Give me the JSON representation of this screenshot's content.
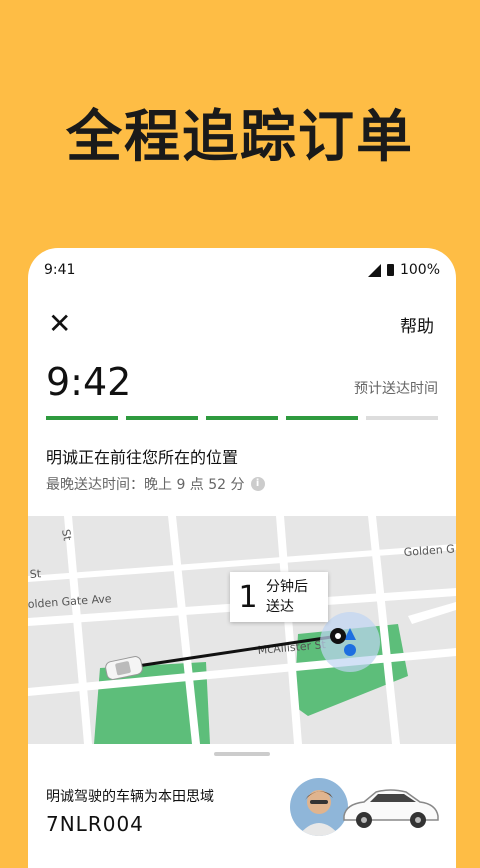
{
  "headline": "全程追踪订单",
  "status_bar": {
    "time": "9:41",
    "battery": "100%"
  },
  "header": {
    "help_label": "帮助"
  },
  "eta": {
    "time": "9:42",
    "label": "预计送达时间",
    "progress": {
      "segments_total": 5,
      "segments_done": 4
    }
  },
  "driver": {
    "status_text": "明诚正在前往您所在的位置",
    "latest_time": "最晚送达时间：晚上 9 点 52 分",
    "car_description": "明诚驾驶的车辆为本田思域",
    "plate": "7NLR004"
  },
  "map": {
    "bubble": {
      "number": "1",
      "line1": "分钟后",
      "line2": "送达"
    },
    "streets": [
      "St",
      "Golden G",
      "St",
      "olden Gate Ave",
      "McAllister St"
    ]
  },
  "colors": {
    "background": "#FEBD45",
    "progress": "#2E9A3E",
    "route": "#000000",
    "park": "#5DBE7A",
    "user_dot": "#1E6FE0"
  }
}
